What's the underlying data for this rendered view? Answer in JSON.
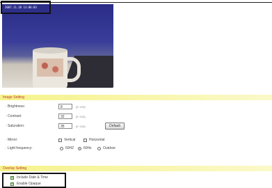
{
  "camera": {
    "timestamp": "2007.11.28 13:06:03"
  },
  "image_setting": {
    "header": "Image Setting",
    "brightness_label": "· Brightness:",
    "brightness_value": "8",
    "brightness_hint": "[0~100]",
    "contrast_label": "· Contrast:",
    "contrast_value": "32",
    "contrast_hint": "[0~100]",
    "saturation_label": "· Saturation:",
    "saturation_value": "35",
    "saturation_hint": "[0~100]",
    "default_label": "Default",
    "mirror_label": "· Mirror:",
    "vertical_label": "Vertical",
    "horizontal_label": "Horizontal",
    "light_freq_label": "· Light frequency:",
    "freq_50": "50HZ",
    "freq_60": "60Hz",
    "freq_outdoor": "Outdoor",
    "selected_freq": "60Hz"
  },
  "overlay_setting": {
    "header": "Overlay Setting",
    "include_datetime_label": "Include Date & Time",
    "enable_opaque_label": "Enable Opaque",
    "include_datetime_checked": true,
    "enable_opaque_checked": true
  }
}
